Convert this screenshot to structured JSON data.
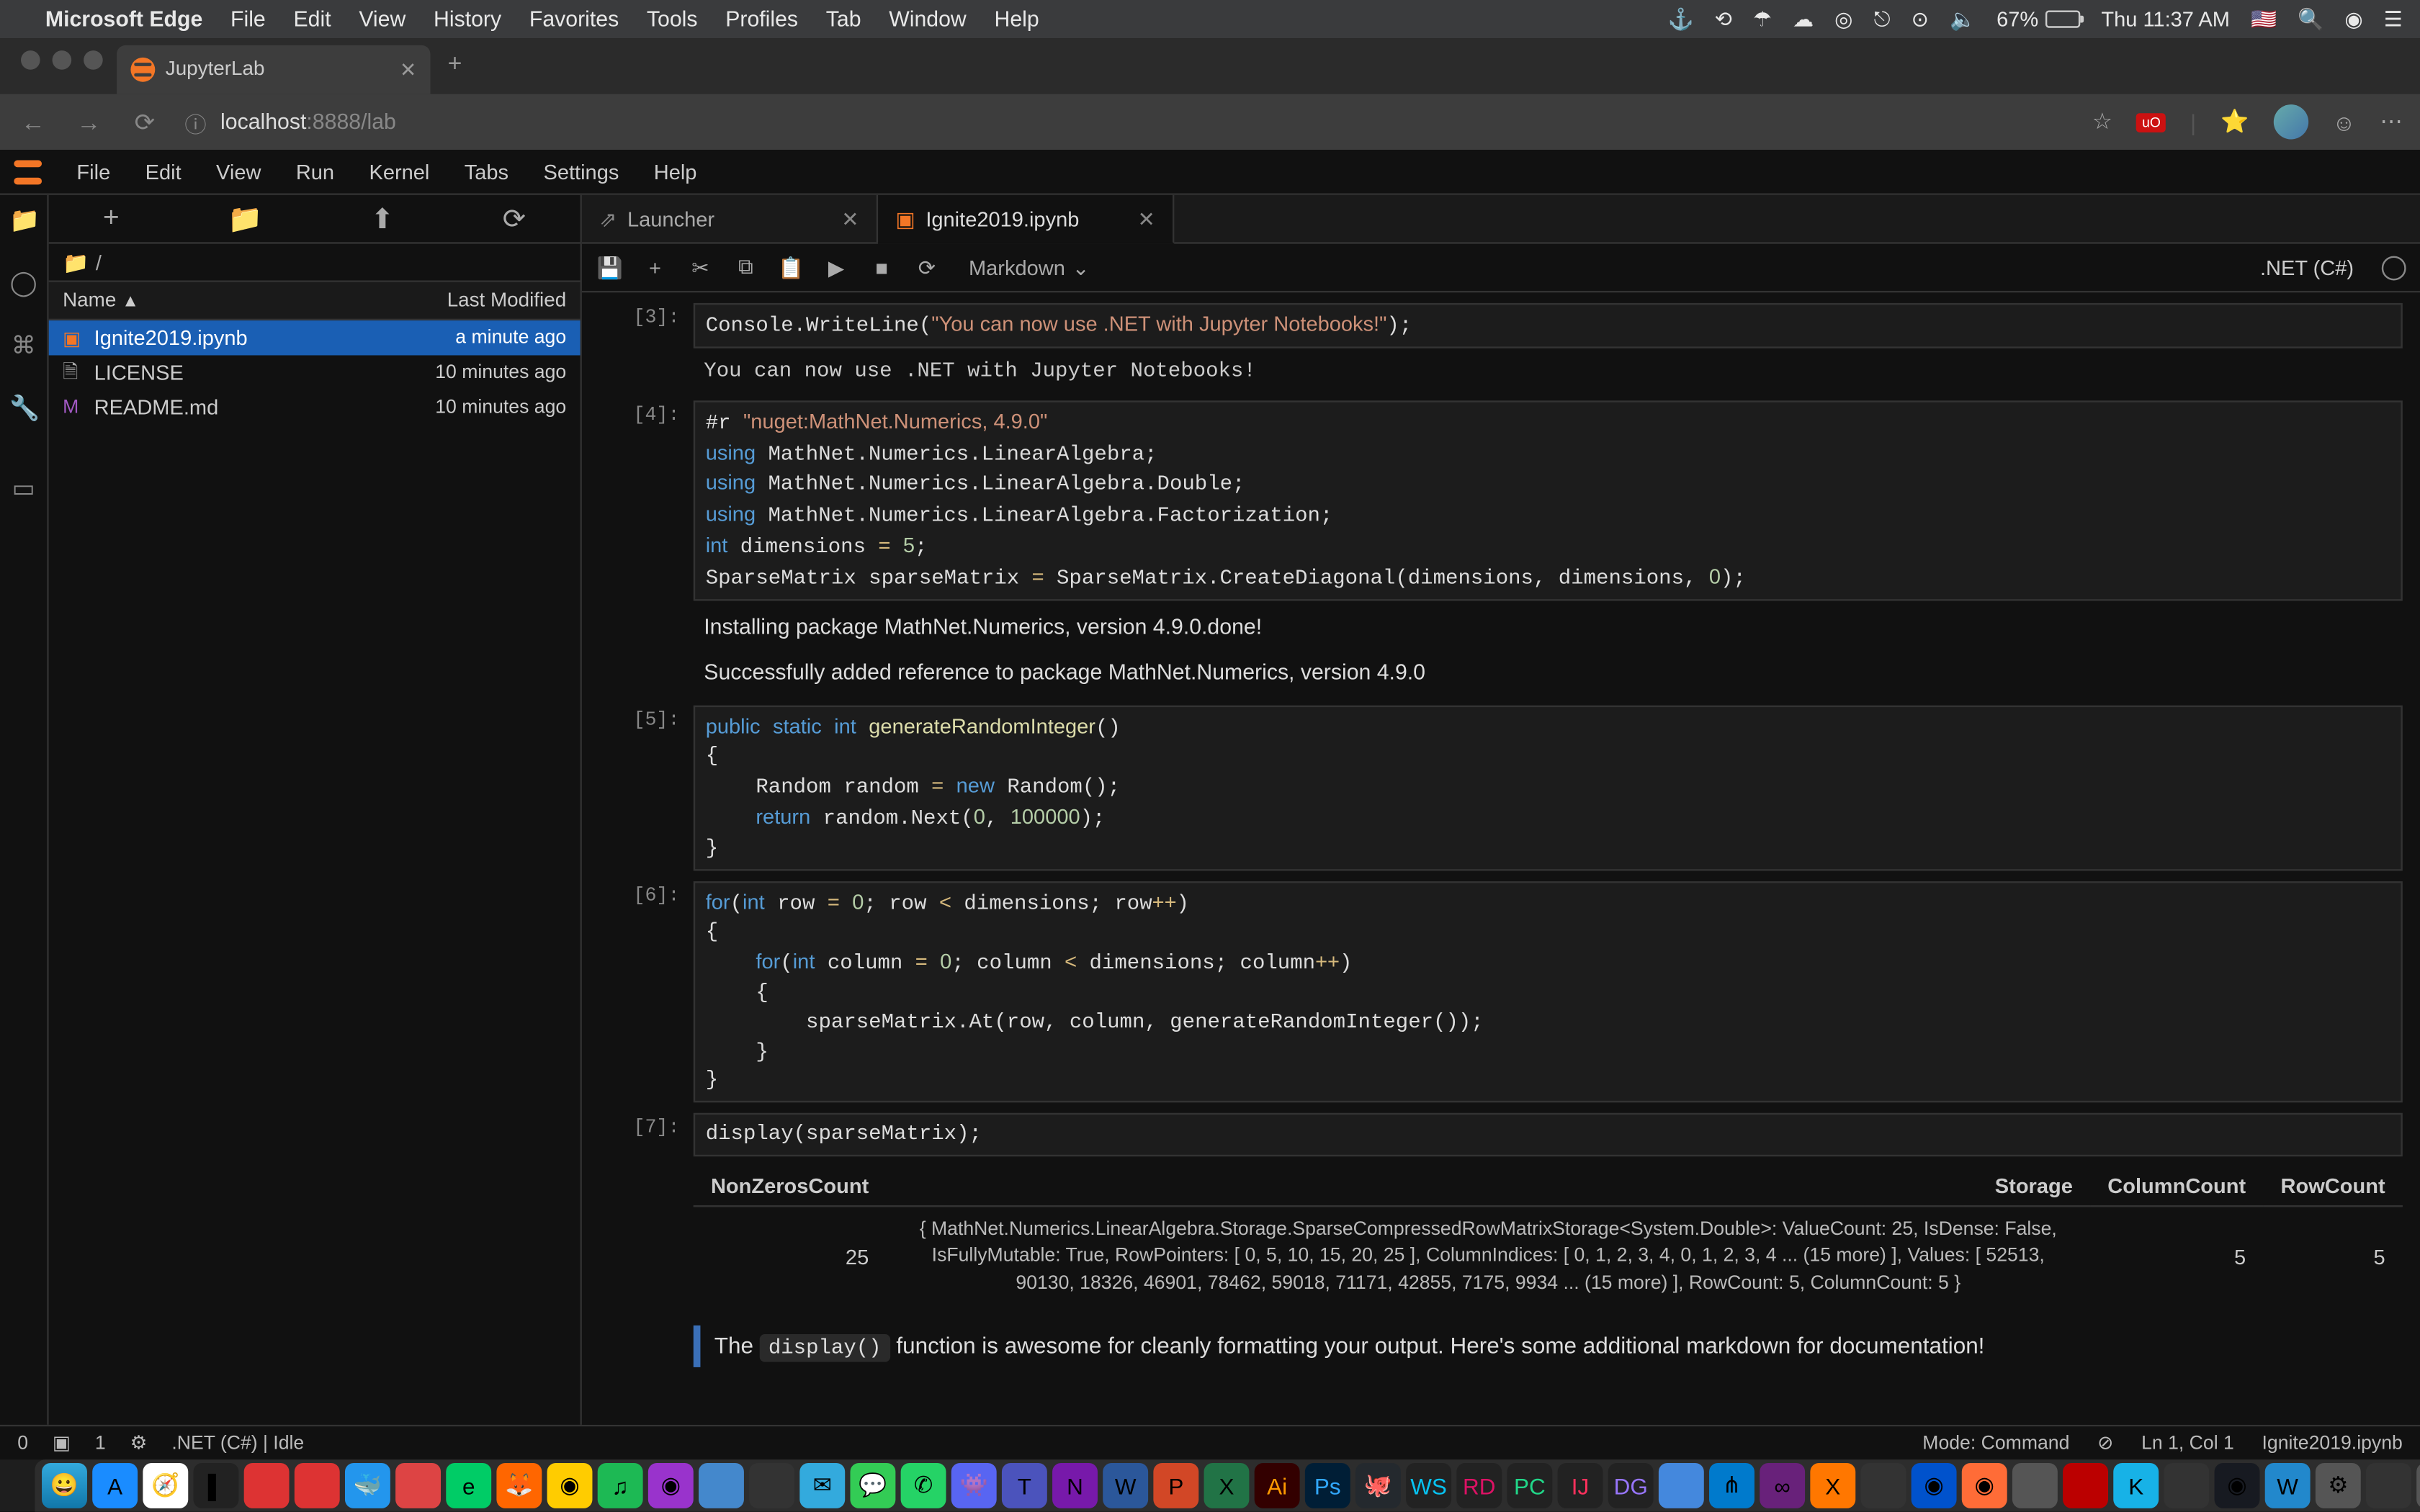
{
  "mac_menu": {
    "app": "Microsoft Edge",
    "items": [
      "File",
      "Edit",
      "View",
      "History",
      "Favorites",
      "Tools",
      "Profiles",
      "Tab",
      "Window",
      "Help"
    ],
    "battery_pct": "67%",
    "clock": "Thu 11:37 AM"
  },
  "browser": {
    "tab_title": "JupyterLab",
    "url_host": "localhost",
    "url_port": ":8888",
    "url_path": "/lab",
    "ext_badge": "uO"
  },
  "jl_menu": [
    "File",
    "Edit",
    "View",
    "Run",
    "Kernel",
    "Tabs",
    "Settings",
    "Help"
  ],
  "sidebar": {
    "breadcrumb_root": "/",
    "col_name": "Name",
    "col_modified": "Last Modified",
    "files": [
      {
        "icon": "nb",
        "name": "Ignite2019.ipynb",
        "time": "a minute ago",
        "sel": true
      },
      {
        "icon": "file",
        "name": "LICENSE",
        "time": "10 minutes ago",
        "sel": false
      },
      {
        "icon": "md",
        "name": "README.md",
        "time": "10 minutes ago",
        "sel": false
      }
    ]
  },
  "nb_tabs": [
    {
      "label": "Launcher",
      "active": false,
      "icon": "launch"
    },
    {
      "label": "Ignite2019.ipynb",
      "active": true,
      "icon": "nb"
    }
  ],
  "nb_toolbar": {
    "cell_type": "Markdown",
    "kernel": ".NET (C#)"
  },
  "cells": {
    "c3_prompt": "[3]:",
    "c3_out": "You can now use .NET with Jupyter Notebooks!",
    "c4_prompt": "[4]:",
    "c4_out1": "Installing package MathNet.Numerics, version 4.9.0.done!",
    "c4_out2": "Successfully added reference to package MathNet.Numerics, version 4.9.0",
    "c5_prompt": "[5]:",
    "c6_prompt": "[6]:",
    "c7_prompt": "[7]:"
  },
  "display_table": {
    "headers": [
      "NonZerosCount",
      "Storage",
      "ColumnCount",
      "RowCount"
    ],
    "nonzeros": "25",
    "storage": "{ MathNet.Numerics.LinearAlgebra.Storage.SparseCompressedRowMatrixStorage<System.Double>: ValueCount: 25, IsDense: False, IsFullyMutable: True, RowPointers: [ 0, 5, 10, 15, 20, 25 ], ColumnIndices: [ 0, 1, 2, 3, 4, 0, 1, 2, 3, 4 ... (15 more) ], Values: [ 52513, 90130, 18326, 46901, 78462, 59018, 71171, 42855, 7175, 9934 ... (15 more) ], RowCount: 5, ColumnCount: 5 }",
    "colcount": "5",
    "rowcount": "5"
  },
  "md_text_pre": "The ",
  "md_code": "display()",
  "md_text_post": " function is awesome for cleanly formatting your output. Here's some additional markdown for documentation!",
  "status": {
    "left1": "0",
    "left2": "1",
    "kernel": ".NET (C#) | Idle",
    "mode": "Mode: Command",
    "pos": "Ln 1, Col 1",
    "file": "Ignite2019.ipynb"
  }
}
